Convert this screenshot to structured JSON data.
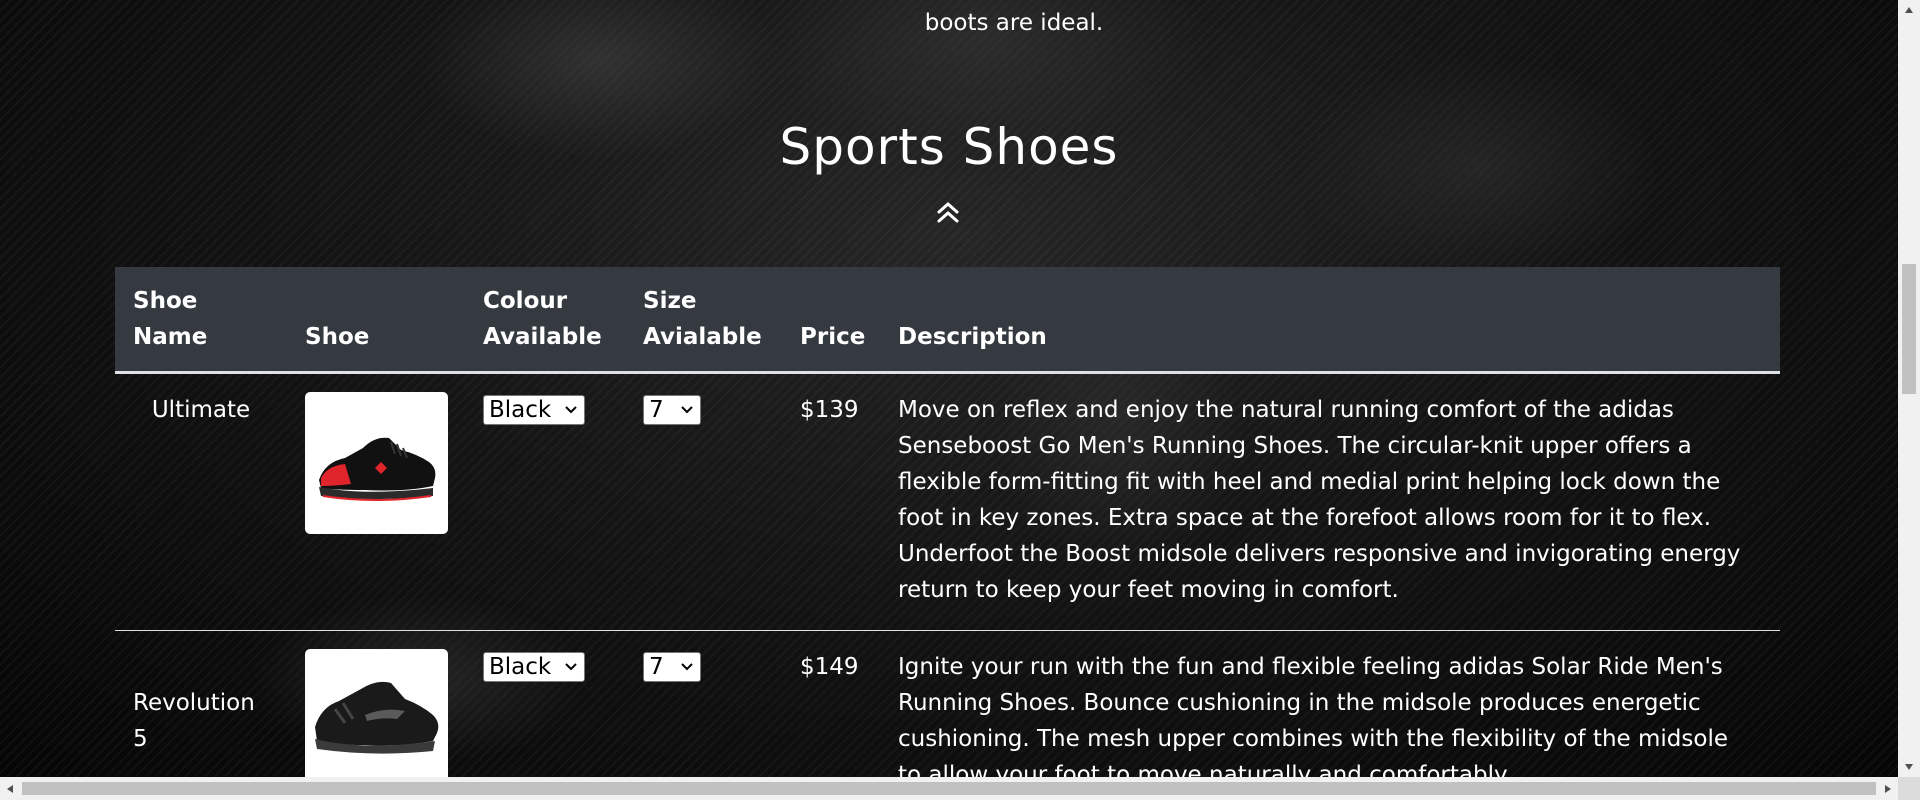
{
  "intro": {
    "tail_text": "boots are ideal."
  },
  "section": {
    "title": "Sports Shoes",
    "scroll_icon": "double-chevron-up-icon"
  },
  "table": {
    "headers": {
      "shoe_name": "Shoe Name",
      "shoe": "Shoe",
      "colour": "Colour Available",
      "size": "Size Avialable",
      "price": "Price",
      "description": "Description"
    },
    "rows": [
      {
        "name": "Ultimate",
        "image_icon": "black-red-running-shoe-image",
        "colour": "Black",
        "size": "7",
        "price": "$139",
        "description": "Move on reflex and enjoy the natural running comfort of the adidas Senseboost Go Men's Running Shoes. The circular-knit upper offers a flexible form-fitting fit with heel and medial print helping lock down the foot in key zones. Extra space at the forefoot allows room for it to flex. Underfoot the Boost midsole delivers responsive and invigorating energy return to keep your feet moving in comfort."
      },
      {
        "name": "Revolution 5",
        "image_icon": "black-running-shoe-image",
        "colour": "Black",
        "size": "7",
        "price": "$149",
        "description": "Ignite your run with the fun and flexible feeling adidas Solar Ride Men's Running Shoes. Bounce cushioning in the midsole produces energetic cushioning. The mesh upper combines with the flexibility of the midsole to allow your foot to move naturally and comfortably."
      }
    ]
  },
  "colors": {
    "header_bg": "#343a40",
    "row_border": "#dee2e6",
    "text": "#ffffff",
    "shoe_accent_red": "#e0242c"
  }
}
